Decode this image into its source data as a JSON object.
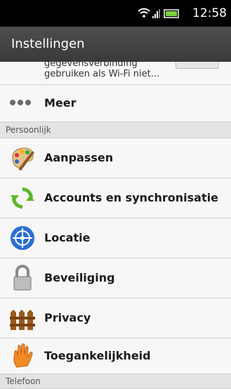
{
  "status_bar": {
    "time": "12:58"
  },
  "header": {
    "title": "Instellingen"
  },
  "partial_item": {
    "line1": "gegevensverbinding",
    "line2": "gebruiken als Wi-Fi niet..."
  },
  "items_top": [
    {
      "label": "Meer",
      "icon": "more-dots-icon"
    }
  ],
  "sections": {
    "personal": "Persoonlijk",
    "phone": "Telefoon"
  },
  "personal_items": [
    {
      "label": "Aanpassen",
      "icon": "palette-icon"
    },
    {
      "label": "Accounts en synchronisatie",
      "icon": "sync-icon"
    },
    {
      "label": "Locatie",
      "icon": "globe-location-icon"
    },
    {
      "label": "Beveiliging",
      "icon": "padlock-icon"
    },
    {
      "label": "Privacy",
      "icon": "fence-icon"
    },
    {
      "label": "Toegankelijkheid",
      "icon": "hand-icon"
    }
  ]
}
